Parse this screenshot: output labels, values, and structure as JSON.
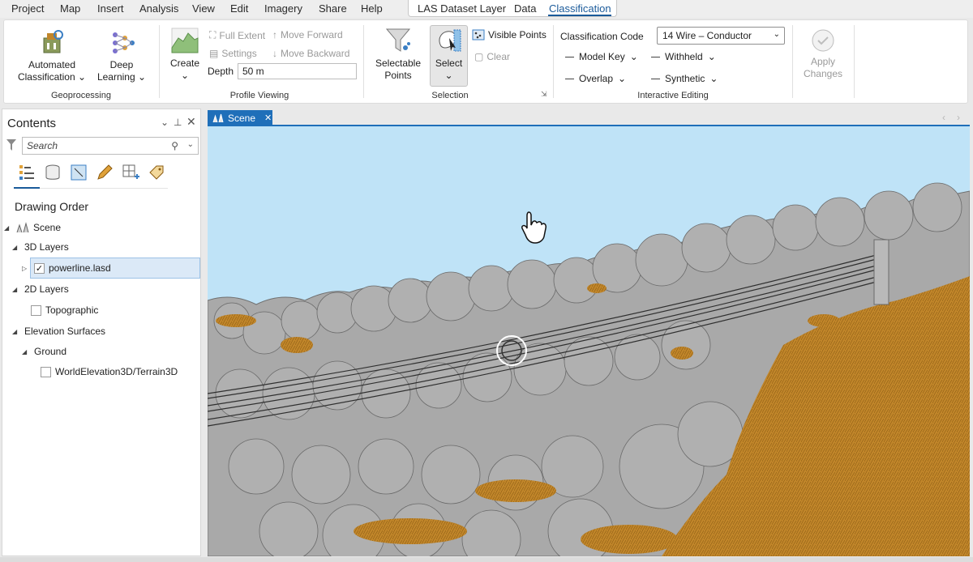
{
  "menu": {
    "items": [
      "Project",
      "Map",
      "Insert",
      "Analysis",
      "View",
      "Edit",
      "Imagery",
      "Share",
      "Help"
    ],
    "context_tabs": [
      "LAS Dataset Layer",
      "Data",
      "Classification"
    ],
    "active_tab": "Classification"
  },
  "ribbon": {
    "geoprocessing": {
      "label": "Geoprocessing",
      "automated_line1": "Automated",
      "automated_line2": "Classification",
      "deep_line1": "Deep",
      "deep_line2": "Learning"
    },
    "profile_viewing": {
      "label": "Profile Viewing",
      "create": "Create",
      "full_extent": "Full Extent",
      "move_forward": "Move Forward",
      "settings": "Settings",
      "move_backward": "Move Backward",
      "depth_label": "Depth",
      "depth_value": "50 m"
    },
    "selection": {
      "label": "Selection",
      "selectable_line1": "Selectable",
      "selectable_line2": "Points",
      "select": "Select",
      "visible_points": "Visible Points",
      "clear": "Clear"
    },
    "interactive_editing": {
      "label": "Interactive Editing",
      "classification_code_label": "Classification Code",
      "classification_code_value": "14 Wire – Conductor",
      "model_key": "Model Key",
      "withheld": "Withheld",
      "overlap": "Overlap",
      "synthetic": "Synthetic"
    },
    "apply": {
      "line1": "Apply",
      "line2": "Changes"
    }
  },
  "contents": {
    "title": "Contents",
    "search_placeholder": "Search",
    "heading": "Drawing Order",
    "tree": {
      "scene": "Scene",
      "layers_3d": "3D Layers",
      "powerline": "powerline.lasd",
      "layers_2d": "2D Layers",
      "topographic": "Topographic",
      "elevation_surfaces": "Elevation Surfaces",
      "ground": "Ground",
      "world_elevation": "WorldElevation3D/Terrain3D"
    }
  },
  "scene": {
    "tab_label": "Scene"
  },
  "colors": {
    "accent": "#1f6fb9",
    "sky": "#bfe3f7",
    "vegetation": "#a7a7a7",
    "ground": "#c1862a"
  }
}
